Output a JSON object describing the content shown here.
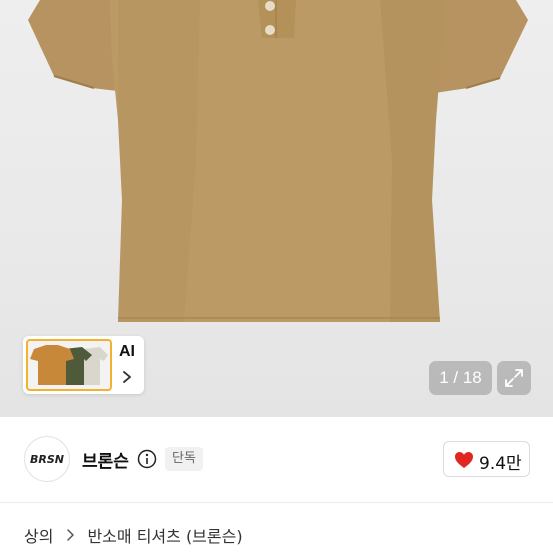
{
  "gallery": {
    "current_index": "1 / 18",
    "thumbnail_label": "AI",
    "thumbnail_colors": [
      "#c8883a",
      "#4f5a3a",
      "#d9d6cc"
    ]
  },
  "seller": {
    "name": "브론슨",
    "badge": "단독",
    "avatar_text": "BRSN"
  },
  "like": {
    "count": "9.4만"
  },
  "breadcrumb": {
    "root": "상의",
    "current": "반소매 티셔츠 (브론슨)"
  },
  "colors": {
    "shirt": "#bc9a66",
    "heart": "#e0261f",
    "accent_border": "#f2b22e"
  }
}
